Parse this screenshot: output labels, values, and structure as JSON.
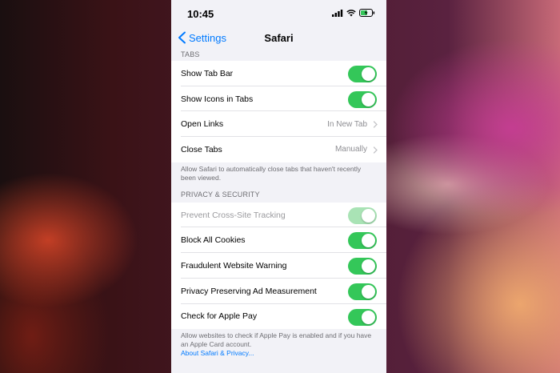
{
  "status_bar": {
    "time": "10:45"
  },
  "nav": {
    "back_label": "Settings",
    "title": "Safari"
  },
  "tabs_section": {
    "header": "TABS",
    "rows": [
      {
        "label": "Show Tab Bar",
        "toggle": true
      },
      {
        "label": "Show Icons in Tabs",
        "toggle": true
      },
      {
        "label": "Open Links",
        "value": "In New Tab"
      },
      {
        "label": "Close Tabs",
        "value": "Manually"
      }
    ],
    "footer": "Allow Safari to automatically close tabs that haven't recently been viewed."
  },
  "privacy_section": {
    "header": "PRIVACY & SECURITY",
    "rows": [
      {
        "label": "Prevent Cross-Site Tracking",
        "toggle": true,
        "disabled": true
      },
      {
        "label": "Block All Cookies",
        "toggle": true
      },
      {
        "label": "Fraudulent Website Warning",
        "toggle": true
      },
      {
        "label": "Privacy Preserving Ad Measurement",
        "toggle": true
      },
      {
        "label": "Check for Apple Pay",
        "toggle": true
      }
    ],
    "footer": "Allow websites to check if Apple Pay is enabled and if you have an Apple Card account.",
    "footer_link": "About Safari & Privacy..."
  },
  "colors": {
    "accent": "#007aff",
    "toggle_on": "#34c759",
    "background": "#f2f2f7"
  }
}
